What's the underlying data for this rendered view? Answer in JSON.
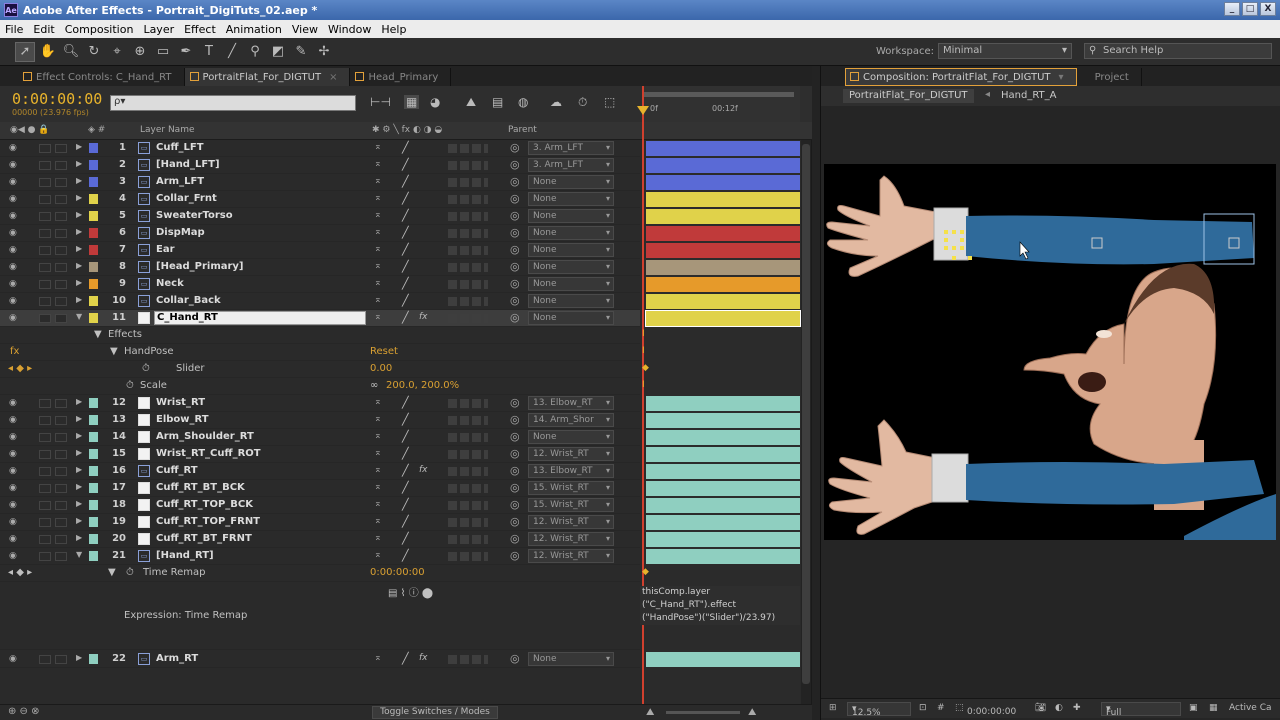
{
  "window": {
    "title": "Adobe After Effects - Portrait_DigiTuts_02.aep *",
    "logo": "Ae",
    "buttons": [
      "_",
      "□",
      "X"
    ]
  },
  "menu": [
    "File",
    "Edit",
    "Composition",
    "Layer",
    "Effect",
    "Animation",
    "View",
    "Window",
    "Help"
  ],
  "toolbar": {
    "tools": [
      "selection-tool",
      "hand-tool",
      "zoom-tool",
      "rotate-tool",
      "camera-orbit-tool",
      "pan-behind-tool",
      "mask-tool",
      "pen-tool",
      "type-tool",
      "brush-tool",
      "clone-tool",
      "eraser-tool",
      "roto-brush-tool",
      "puppet-tool"
    ],
    "workspace_label": "Workspace:",
    "workspace_value": "Minimal",
    "search_help": "Search Help"
  },
  "left_tabs": [
    {
      "label": "Effect Controls: C_Hand_RT",
      "active": false
    },
    {
      "label": "PortraitFlat_For_DIGTUT",
      "active": true
    },
    {
      "label": "Head_Primary",
      "active": false
    }
  ],
  "timeline": {
    "timecode": "0:00:00:00",
    "fps": "00000 (23.976 fps)",
    "search_placeholder": "ρ▾",
    "ruler_labels": [
      "0f",
      "00:12f"
    ],
    "col_headers": {
      "layer_name": "Layer Name",
      "parent": "Parent"
    },
    "toggle_switches": "Toggle Switches / Modes"
  },
  "layers": [
    {
      "num": "1",
      "name": "Cuff_LFT",
      "color": "#5a6ad6",
      "type": "precomp",
      "parent": "3. Arm_LFT",
      "fx": false
    },
    {
      "num": "2",
      "name": "[Hand_LFT]",
      "color": "#5a6ad6",
      "type": "precomp",
      "parent": "3. Arm_LFT",
      "fx": false
    },
    {
      "num": "3",
      "name": "Arm_LFT",
      "color": "#5a6ad6",
      "type": "precomp",
      "parent": "None",
      "fx": false
    },
    {
      "num": "4",
      "name": "Collar_Frnt",
      "color": "#e0d24a",
      "type": "precomp",
      "parent": "None",
      "fx": false
    },
    {
      "num": "5",
      "name": "SweaterTorso",
      "color": "#e0d24a",
      "type": "precomp",
      "parent": "None",
      "fx": false
    },
    {
      "num": "6",
      "name": "DispMap",
      "color": "#c03a3a",
      "type": "precomp",
      "parent": "None",
      "fx": false
    },
    {
      "num": "7",
      "name": "Ear",
      "color": "#c03a3a",
      "type": "precomp",
      "parent": "None",
      "fx": false
    },
    {
      "num": "8",
      "name": "[Head_Primary]",
      "color": "#a7967a",
      "type": "precomp",
      "parent": "None",
      "fx": false
    },
    {
      "num": "9",
      "name": "Neck",
      "color": "#e69a2a",
      "type": "precomp",
      "parent": "None",
      "fx": false
    },
    {
      "num": "10",
      "name": "Collar_Back",
      "color": "#e0d24a",
      "type": "precomp",
      "parent": "None",
      "fx": false
    },
    {
      "num": "11",
      "name": "C_Hand_RT",
      "color": "#e0d24a",
      "type": "solid",
      "parent": "None",
      "fx": true
    }
  ],
  "effects_block": {
    "effects_label": "Effects",
    "effect_name": "HandPose",
    "reset": "Reset",
    "slider_label": "Slider",
    "slider_value": "0.00",
    "scale_label": "Scale",
    "scale_value": "200.0, 200.0%"
  },
  "layers2": [
    {
      "num": "12",
      "name": "Wrist_RT",
      "color": "#8fcfc0",
      "type": "solid",
      "parent": "13. Elbow_RT",
      "fx": false
    },
    {
      "num": "13",
      "name": "Elbow_RT",
      "color": "#8fcfc0",
      "type": "solid",
      "parent": "14. Arm_Shor",
      "fx": false
    },
    {
      "num": "14",
      "name": "Arm_Shoulder_RT",
      "color": "#8fcfc0",
      "type": "solid",
      "parent": "None",
      "fx": false
    },
    {
      "num": "15",
      "name": "Wrist_RT_Cuff_ROT",
      "color": "#8fcfc0",
      "type": "solid",
      "parent": "12. Wrist_RT",
      "fx": false
    },
    {
      "num": "16",
      "name": "Cuff_RT",
      "color": "#8fcfc0",
      "type": "precomp",
      "parent": "13. Elbow_RT",
      "fx": true
    },
    {
      "num": "17",
      "name": "Cuff_RT_BT_BCK",
      "color": "#8fcfc0",
      "type": "solid",
      "parent": "15. Wrist_RT",
      "fx": false
    },
    {
      "num": "18",
      "name": "Cuff_RT_TOP_BCK",
      "color": "#8fcfc0",
      "type": "solid",
      "parent": "15. Wrist_RT",
      "fx": false
    },
    {
      "num": "19",
      "name": "Cuff_RT_TOP_FRNT",
      "color": "#8fcfc0",
      "type": "solid",
      "parent": "12. Wrist_RT",
      "fx": false
    },
    {
      "num": "20",
      "name": "Cuff_RT_BT_FRNT",
      "color": "#8fcfc0",
      "type": "solid",
      "parent": "12. Wrist_RT",
      "fx": false
    },
    {
      "num": "21",
      "name": "[Hand_RT]",
      "color": "#8fcfc0",
      "type": "precomp",
      "parent": "12. Wrist_RT",
      "fx": false
    }
  ],
  "time_remap": {
    "label": "Time Remap",
    "value": "0:00:00:00",
    "expression_label": "Expression: Time Remap",
    "expression_lines": [
      "thisComp.layer",
      "(\"C_Hand_RT\").effect",
      "(\"HandPose\")(\"Slider\")/23.97)"
    ]
  },
  "layer22": {
    "num": "22",
    "name": "Arm_RT",
    "color": "#8fcfc0",
    "type": "precomp",
    "parent": "None",
    "fx": true
  },
  "comp": {
    "tabs": [
      {
        "label": "Composition: PortraitFlat_For_DIGTUT",
        "active": true
      },
      {
        "label": "Project",
        "active": false
      }
    ],
    "breadcrumbs": [
      "PortraitFlat_For_DIGTUT",
      "Hand_RT_A"
    ],
    "zoom": "12.5%",
    "timecode": "0:00:00:00",
    "resolution": "Full",
    "view": "Active Ca"
  },
  "colors": {
    "accent": "#e8b32c",
    "cti": "#d0402e",
    "sweater": "#2f6a9a"
  }
}
